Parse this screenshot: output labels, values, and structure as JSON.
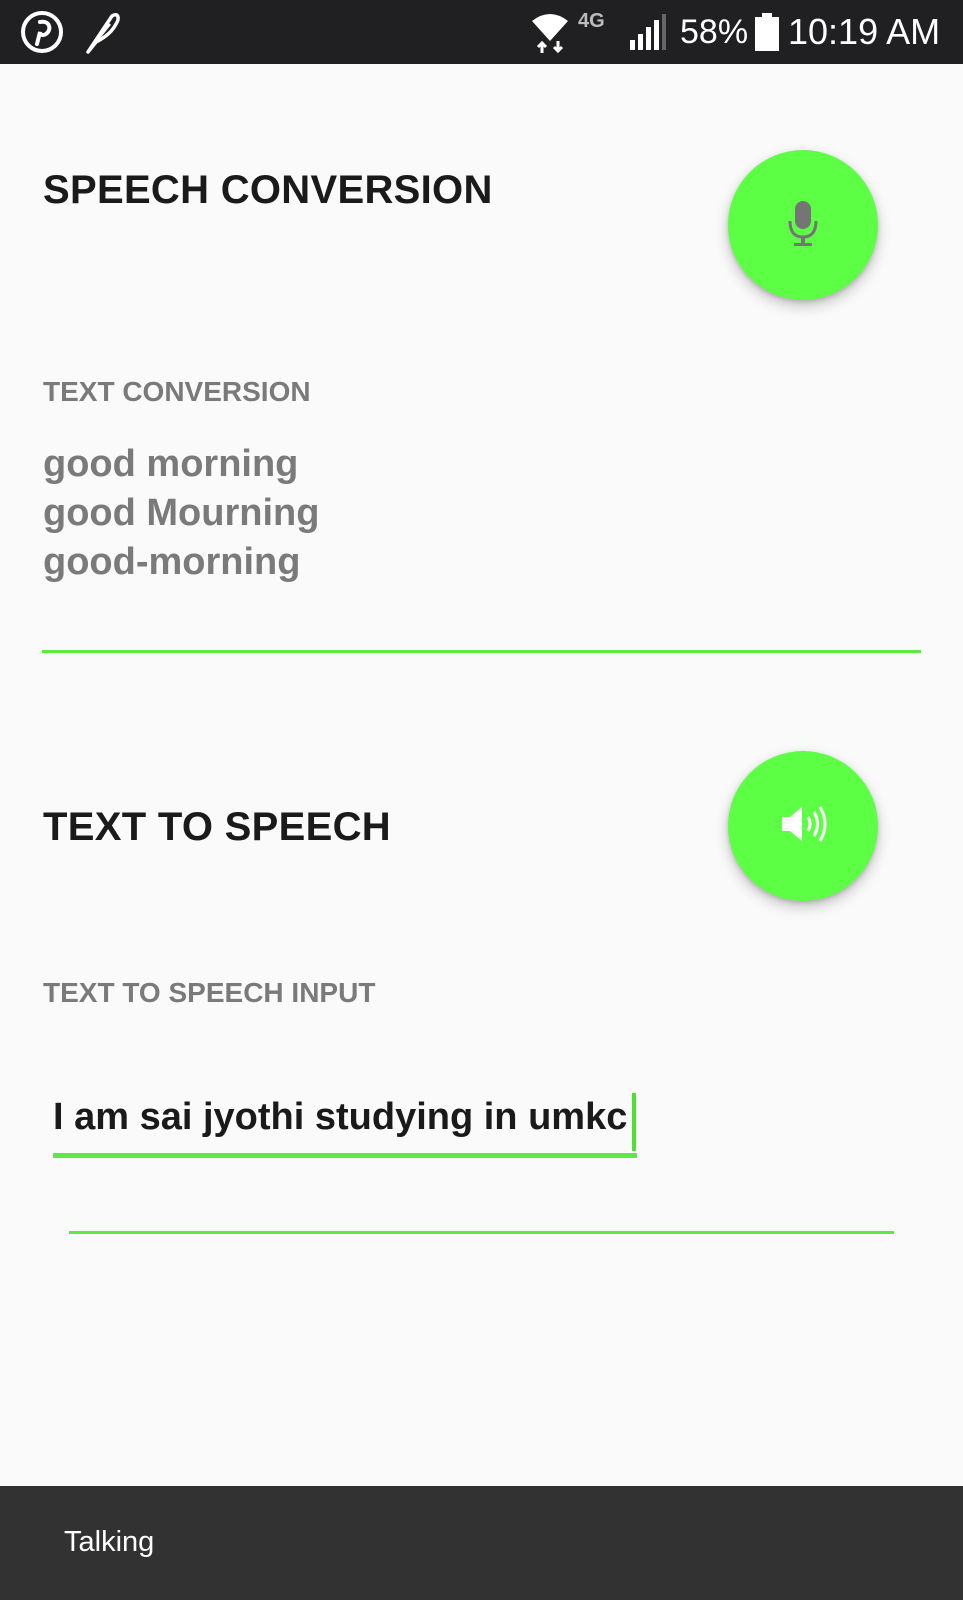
{
  "status_bar": {
    "network": "4G",
    "battery": "58%",
    "time": "10:19 AM",
    "icons": [
      "pinterest-icon",
      "feather-icon",
      "wifi-icon",
      "lte-icon",
      "signal-icon",
      "battery-icon"
    ]
  },
  "speech_conversion": {
    "title": "SPEECH CONVERSION",
    "button_icon": "microphone-icon",
    "label": "TEXT CONVERSION",
    "results": [
      "good morning",
      "good Mourning",
      "good-morning"
    ]
  },
  "text_to_speech": {
    "title": "TEXT TO SPEECH",
    "button_icon": "speaker-icon",
    "label": "TEXT TO SPEECH INPUT",
    "input_value": "I am sai jyothi studying in umkc"
  },
  "snackbar": {
    "text": "Talking"
  },
  "colors": {
    "accent": "#5cff44",
    "status_bar": "#202022",
    "snackbar": "#323232",
    "background": "#fafafa"
  }
}
